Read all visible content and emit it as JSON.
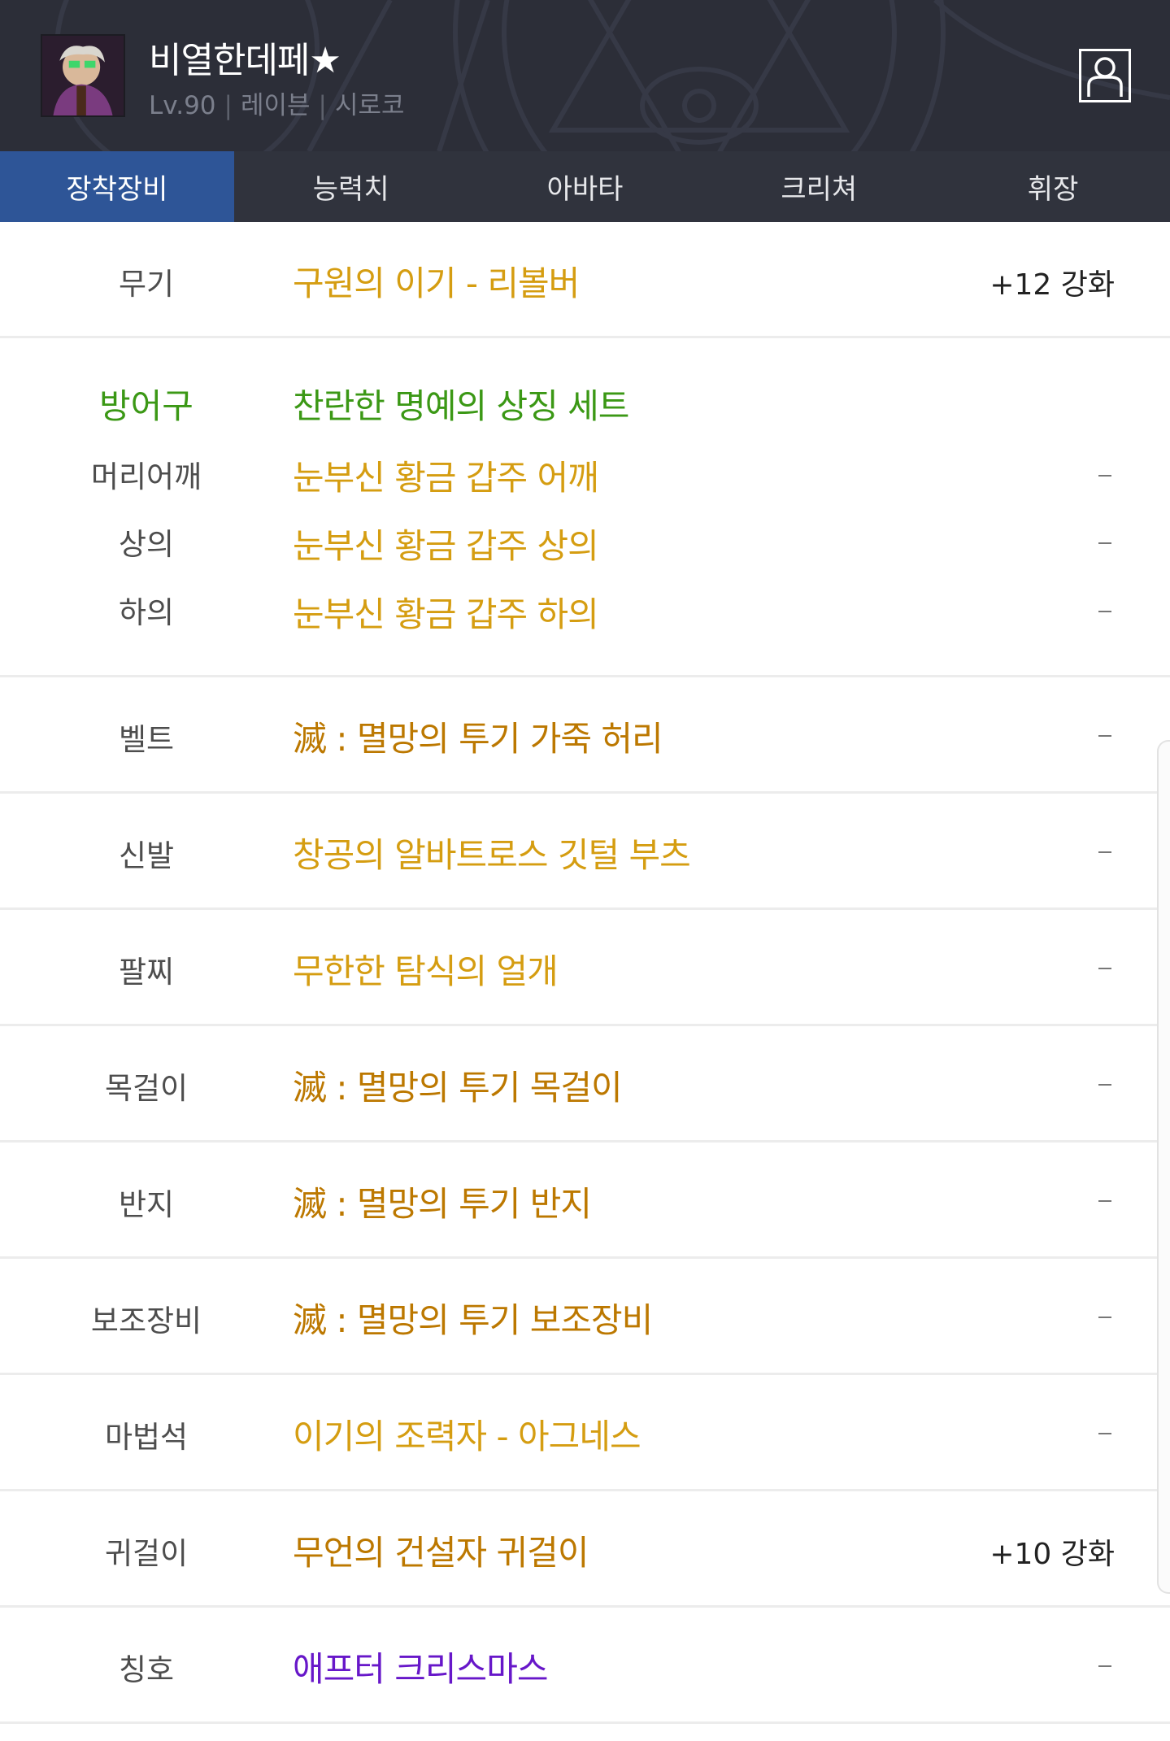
{
  "header": {
    "character_name": "비열한데페★",
    "level": "Lv.90",
    "job": "레이븐",
    "server": "시로코",
    "separator": "|",
    "avatar_icon": "character-portrait",
    "profile_icon": "person-icon"
  },
  "tabs": [
    {
      "label": "장착장비",
      "active": true
    },
    {
      "label": "능력치",
      "active": false
    },
    {
      "label": "아바타",
      "active": false
    },
    {
      "label": "크리쳐",
      "active": false
    },
    {
      "label": "휘장",
      "active": false
    }
  ],
  "colors": {
    "header_bg": "#2c2e38",
    "active_tab": "#2e5597",
    "unique_orange": "#d59d11",
    "epic_dark_orange": "#bc7800",
    "set_green": "#3b9815",
    "title_purple": "#6717c9"
  },
  "equipment": {
    "weapon": {
      "slot": "무기",
      "item": "구원의 이기 - 리볼버",
      "enhance": "+12 강화"
    },
    "armor": {
      "slot": "방어구",
      "set_name": "찬란한 명예의 상징 세트",
      "pieces": [
        {
          "slot": "머리어깨",
          "item": "눈부신 황금 갑주 어깨",
          "enhance": "-"
        },
        {
          "slot": "상의",
          "item": "눈부신 황금 갑주 상의",
          "enhance": "-"
        },
        {
          "slot": "하의",
          "item": "눈부신 황금 갑주 하의",
          "enhance": "-"
        }
      ]
    },
    "belt": {
      "slot": "벨트",
      "item": "滅 : 멸망의 투기 가죽 허리",
      "enhance": "-"
    },
    "shoes": {
      "slot": "신발",
      "item": "창공의 알바트로스 깃털 부츠",
      "enhance": "-"
    },
    "bracelet": {
      "slot": "팔찌",
      "item": "무한한 탐식의 얼개",
      "enhance": "-"
    },
    "necklace": {
      "slot": "목걸이",
      "item": "滅 : 멸망의 투기 목걸이",
      "enhance": "-"
    },
    "ring": {
      "slot": "반지",
      "item": "滅 : 멸망의 투기 반지",
      "enhance": "-"
    },
    "support": {
      "slot": "보조장비",
      "item": "滅 : 멸망의 투기 보조장비",
      "enhance": "-"
    },
    "magic_stone": {
      "slot": "마법석",
      "item": "이기의 조력자 - 아그네스",
      "enhance": "-"
    },
    "earring": {
      "slot": "귀걸이",
      "item": "무언의 건설자 귀걸이",
      "enhance": "+10 강화"
    },
    "title": {
      "slot": "칭호",
      "item": "애프터 크리스마스",
      "enhance": "-"
    }
  }
}
